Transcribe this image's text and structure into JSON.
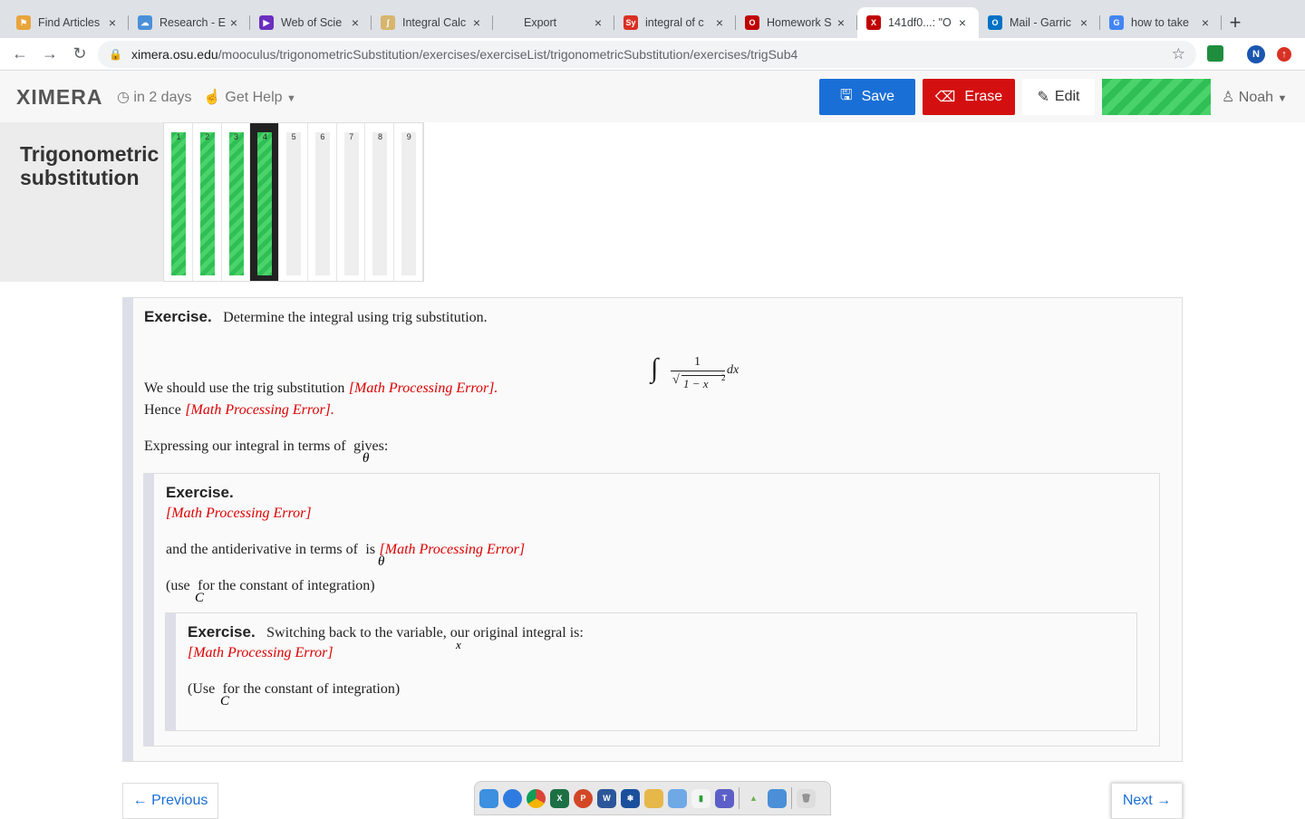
{
  "browser": {
    "tabs": [
      {
        "title": "Find Articles",
        "color": "#e8a53c",
        "glyph": "⚑",
        "active": false
      },
      {
        "title": "Research - E",
        "color": "#4a90d9",
        "glyph": "☁",
        "active": false
      },
      {
        "title": "Web of Scie",
        "color": "#6a2fbf",
        "glyph": "▶",
        "active": false
      },
      {
        "title": "Integral Calc",
        "color": "#d6b56e",
        "glyph": "∫",
        "active": false
      },
      {
        "title": "Export",
        "color": "#ffffff",
        "glyph": "",
        "active": false
      },
      {
        "title": "integral of c",
        "color": "#d93025",
        "glyph": "Sy",
        "active": false
      },
      {
        "title": "Homework S",
        "color": "#c00000",
        "glyph": "O",
        "active": false
      },
      {
        "title": "141df0...: \"O",
        "color": "#c00000",
        "glyph": "X",
        "active": true
      },
      {
        "title": "Mail - Garric",
        "color": "#0072c6",
        "glyph": "O",
        "active": false
      },
      {
        "title": "how to take",
        "color": "#4285f4",
        "glyph": "G",
        "active": false
      }
    ],
    "url_host": "ximera.osu.edu",
    "url_path": "/mooculus/trigonometricSubstitution/exercises/exerciseList/trigonometricSubstitution/exercises/trigSub4",
    "profile_initial": "N"
  },
  "app": {
    "logo": "XIMERA",
    "due": "in 2 days",
    "help": "Get Help",
    "save": "Save",
    "erase": "Erase",
    "edit": "Edit",
    "user": "Noah"
  },
  "lesson": {
    "title_line1": "Trigonometric",
    "title_line2": "substitution",
    "exercises": [
      {
        "num": "1",
        "done": true
      },
      {
        "num": "2",
        "done": true
      },
      {
        "num": "3",
        "done": true
      },
      {
        "num": "4",
        "done": true,
        "current": true
      },
      {
        "num": "5",
        "done": false
      },
      {
        "num": "6",
        "done": false
      },
      {
        "num": "7",
        "done": false
      },
      {
        "num": "8",
        "done": false
      },
      {
        "num": "9",
        "done": false
      }
    ]
  },
  "content": {
    "ex_label": "Exercise.",
    "prompt": "Determine the integral using trig substitution.",
    "integral_num": "1",
    "integral_rad": "1 − x",
    "integral_exp": "2",
    "integral_dx": "dx",
    "line_sub": "We should use the trig substitution",
    "hence": "Hence",
    "math_error": "[Math Processing Error]",
    "express": "Expressing our integral in terms of",
    "gives": "gives:",
    "theta": "θ",
    "antideriv": "and the antiderivative in terms of",
    "is": "is",
    "use_c_open": "(use",
    "use_c_rest": "for the constant of integration)",
    "C": "C",
    "switch_back": "Switching back to the variable",
    "switch_rest": ", our original integral is:",
    "x": "x",
    "use_c2_open": "(Use",
    "use_c2_rest": "for the constant of integration)",
    "period": "."
  },
  "pager": {
    "previous": "← Previous",
    "next": "Next →"
  }
}
